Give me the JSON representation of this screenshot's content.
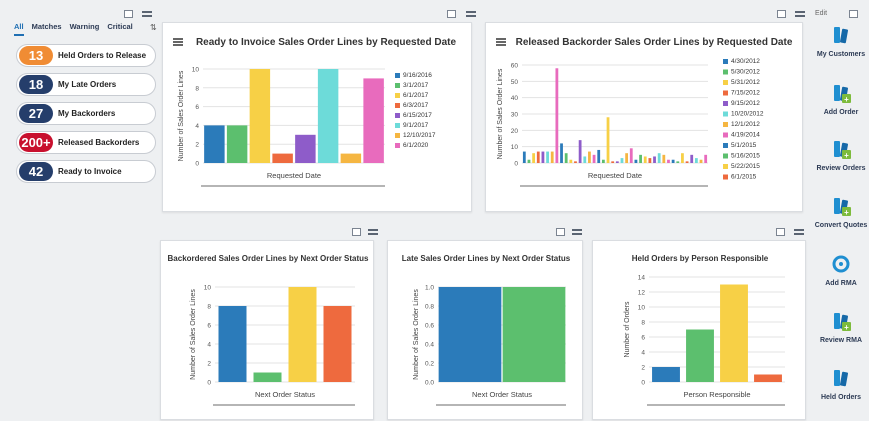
{
  "sidebar": {
    "tabs": [
      "All",
      "Matches",
      "Warning",
      "Critical"
    ],
    "cards": [
      {
        "count": "13",
        "label": "Held Orders to Release",
        "color": "#f08c34"
      },
      {
        "count": "18",
        "label": "My Late Orders",
        "color": "#253e6b"
      },
      {
        "count": "27",
        "label": "My Backorders",
        "color": "#253e6b"
      },
      {
        "count": "200+",
        "label": "Released Backorders",
        "color": "#c8102e"
      },
      {
        "count": "42",
        "label": "Ready to Invoice",
        "color": "#253e6b"
      }
    ]
  },
  "charts": {
    "invoice": {
      "title": "Ready to Invoice Sales Order Lines by Requested Date",
      "ylabel": "Number of Sales Order Lines",
      "xlabel": "Requested Date",
      "ticks": [
        "0",
        "2",
        "4",
        "6",
        "8",
        "10"
      ],
      "legend": [
        "9/16/2016",
        "3/1/2017",
        "6/1/2017",
        "6/3/2017",
        "6/15/2017",
        "9/1/2017",
        "12/10/2017",
        "6/1/2020"
      ]
    },
    "backorder": {
      "title": "Released Backorder Sales Order Lines by Requested Date",
      "ylabel": "Number of Sales Order Lines",
      "xlabel": "Requested Date",
      "ticks": [
        "0",
        "10",
        "20",
        "30",
        "40",
        "50",
        "60"
      ],
      "legend": [
        "4/30/2012",
        "5/30/2012",
        "5/31/2012",
        "7/15/2012",
        "9/15/2012",
        "10/20/2012",
        "12/1/2012",
        "4/19/2014",
        "5/1/2015",
        "5/16/2015",
        "5/22/2015",
        "6/1/2015"
      ]
    },
    "next_status": {
      "title": "Backordered Sales Order Lines by Next Order Status",
      "ylabel": "Number of Sales Order Lines",
      "xlabel": "Next Order Status",
      "ticks": [
        "0",
        "2",
        "4",
        "6",
        "8",
        "10"
      ]
    },
    "late_status": {
      "title": "Late Sales Order Lines by Next Order Status",
      "ylabel": "Number of Sales Order Lines",
      "xlabel": "Next Order Status",
      "ticks": [
        "0.0",
        "0.2",
        "0.4",
        "0.6",
        "0.8",
        "1.0"
      ]
    },
    "held_person": {
      "title": "Held Orders by Person Responsible",
      "ylabel": "Number of Orders",
      "xlabel": "Person Responsible",
      "ticks": [
        "0",
        "2",
        "4",
        "6",
        "8",
        "10",
        "12",
        "14"
      ]
    }
  },
  "chart_data": [
    {
      "type": "bar",
      "title": "Ready to Invoice Sales Order Lines by Requested Date",
      "xlabel": "Requested Date",
      "ylabel": "Number of Sales Order Lines",
      "ylim": [
        0,
        10
      ],
      "categories": [
        "9/16/2016",
        "3/1/2017",
        "6/1/2017",
        "6/3/2017",
        "6/15/2017",
        "9/1/2017",
        "12/10/2017",
        "6/1/2020"
      ],
      "values": [
        4,
        4,
        10,
        1,
        3,
        10,
        1,
        9
      ],
      "colors": [
        "#2b7bba",
        "#5cbf6e",
        "#f7d046",
        "#ee6a3e",
        "#8e5cc9",
        "#6ddbd9",
        "#f5b642",
        "#e86bbd"
      ]
    },
    {
      "type": "bar",
      "title": "Released Backorder Sales Order Lines by Requested Date",
      "xlabel": "Requested Date",
      "ylabel": "Number of Sales Order Lines",
      "ylim": [
        0,
        60
      ],
      "values": [
        7,
        2,
        6,
        7,
        7,
        7,
        7,
        58,
        12,
        6,
        2,
        1,
        14,
        4,
        7,
        5,
        8,
        2,
        28,
        1,
        1,
        3,
        6,
        9,
        2,
        5,
        4,
        3,
        4,
        6,
        5,
        2,
        2,
        1,
        6,
        1,
        5,
        3,
        2,
        5
      ],
      "colors": [
        "#2b7bba",
        "#5cbf6e",
        "#f7d046",
        "#ee6a3e",
        "#8e5cc9",
        "#6ddbd9",
        "#f5b642",
        "#e86bbd"
      ]
    },
    {
      "type": "bar",
      "title": "Backordered Sales Order Lines by Next Order Status",
      "xlabel": "Next Order Status",
      "ylabel": "Number of Sales Order Lines",
      "ylim": [
        0,
        10
      ],
      "values": [
        8,
        1,
        10,
        8
      ],
      "colors": [
        "#2b7bba",
        "#5cbf6e",
        "#f7d046",
        "#ee6a3e"
      ]
    },
    {
      "type": "bar",
      "title": "Late Sales Order Lines by Next Order Status",
      "xlabel": "Next Order Status",
      "ylabel": "Number of Sales Order Lines",
      "ylim": [
        0,
        1
      ],
      "values": [
        1,
        1
      ],
      "colors": [
        "#2b7bba",
        "#5cbf6e"
      ]
    },
    {
      "type": "bar",
      "title": "Held Orders by Person Responsible",
      "xlabel": "Person Responsible",
      "ylabel": "Number of Orders",
      "ylim": [
        0,
        14
      ],
      "values": [
        2,
        7,
        13,
        1
      ],
      "colors": [
        "#2b7bba",
        "#5cbf6e",
        "#f7d046",
        "#ee6a3e"
      ]
    }
  ],
  "actions": [
    {
      "label": "My Customers",
      "icon": "book-icon"
    },
    {
      "label": "Add Order",
      "icon": "add-order-icon"
    },
    {
      "label": "Review Orders",
      "icon": "review-icon"
    },
    {
      "label": "Convert Quotes",
      "icon": "convert-icon"
    },
    {
      "label": "Add RMA",
      "icon": "rma-icon"
    },
    {
      "label": "Review RMA",
      "icon": "review-icon"
    },
    {
      "label": "Held Orders",
      "icon": "book-icon"
    }
  ],
  "topbar": {
    "edit_label": "Edit"
  }
}
